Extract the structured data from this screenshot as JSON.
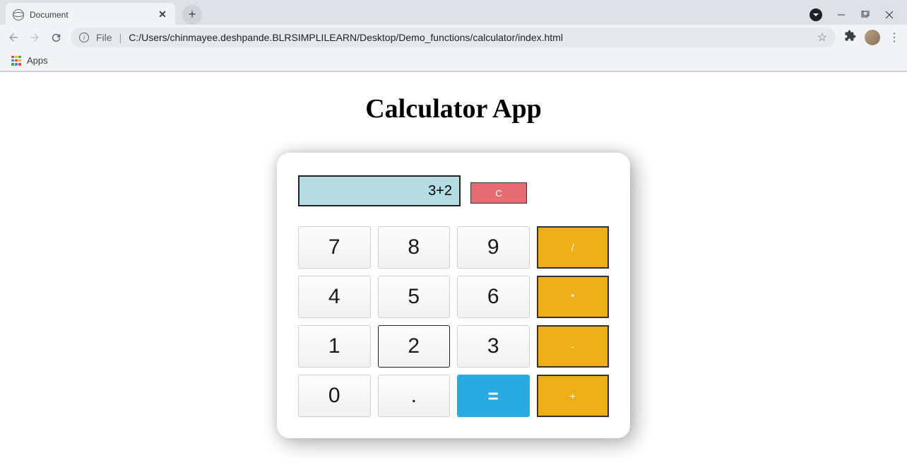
{
  "browser": {
    "tab_title": "Document",
    "url_prefix": "File ",
    "url": "C:/Users/chinmayee.deshpande.BLRSIMPLILEARN/Desktop/Demo_functions/calculator/index.html",
    "bookmarks": {
      "apps": "Apps"
    }
  },
  "page": {
    "title": "Calculator App"
  },
  "calculator": {
    "display_value": "3+2",
    "clear_label": "C",
    "keys": {
      "seven": "7",
      "eight": "8",
      "nine": "9",
      "divide": "/",
      "four": "4",
      "five": "5",
      "six": "6",
      "multiply": "*",
      "one": "1",
      "two": "2",
      "three": "3",
      "minus": "-",
      "zero": "0",
      "dot": ".",
      "equals": "=",
      "plus": "+"
    }
  }
}
